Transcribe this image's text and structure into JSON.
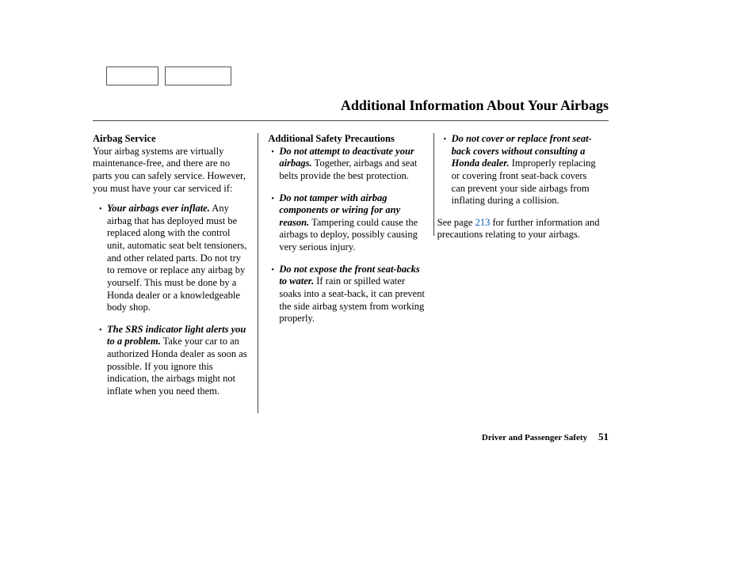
{
  "page_title": "Additional Information About Your Airbags",
  "footer": {
    "chapter": "Driver and Passenger Safety",
    "page_number": "51"
  },
  "col1": {
    "heading": "Airbag Service",
    "intro": "Your airbag systems are virtually maintenance-free, and there are no parts you can safely service. However, you must have your car serviced if:",
    "items": [
      {
        "lead": "Your airbags ever inflate.",
        "body": " Any airbag that has deployed must be replaced along with the control unit, automatic seat belt tensioners, and other related parts. Do not try to remove or replace any airbag by yourself. This must be done by a Honda dealer or a knowledgeable body shop."
      },
      {
        "lead": "The SRS indicator light alerts you to a problem.",
        "body": " Take your car to an authorized Honda dealer as soon as possible. If you ignore this indication, the airbags might not inflate when you need them."
      }
    ]
  },
  "col2": {
    "heading": "Additional Safety Precautions",
    "items": [
      {
        "lead": "Do not attempt to deactivate your airbags.",
        "body": " Together, airbags and seat belts provide the best protection."
      },
      {
        "lead": "Do not tamper with airbag components or wiring for any reason.",
        "body": " Tampering could cause the airbags to deploy, possibly causing very serious injury."
      },
      {
        "lead": "Do not expose the front seat-backs to water.",
        "body": " If rain or spilled water soaks into a seat-back, it can prevent the side airbag system from working properly."
      }
    ]
  },
  "col3": {
    "items": [
      {
        "lead": "Do not cover or replace front seat-back covers without consulting a Honda dealer.",
        "body": " Improperly replacing or covering front seat-back covers can prevent your side airbags from inflating during a collision."
      }
    ],
    "outro_pre": "See page ",
    "outro_link": "213",
    "outro_post": " for further information and precautions relating to your airbags."
  }
}
